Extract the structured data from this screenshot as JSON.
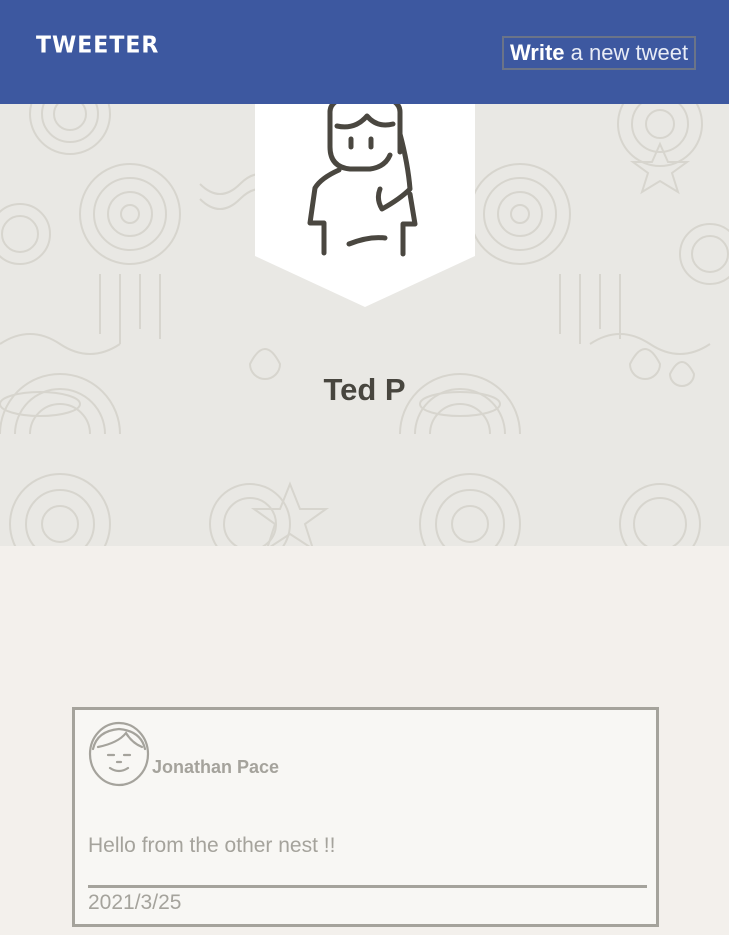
{
  "header": {
    "logo": "TWEETER",
    "write_button": {
      "strong": "Write",
      "rest": " a new tweet"
    }
  },
  "profile": {
    "name": "Ted P"
  },
  "tweets": [
    {
      "author": "Jonathan Pace",
      "text": "Hello from the other nest !!",
      "date": "2021/3/25"
    }
  ],
  "colors": {
    "header_bg": "#3d58a0",
    "page_bg": "#f3f0ec",
    "banner_bg": "#e9e8e4",
    "name_text": "#48463f",
    "card_border": "#a5a39c"
  }
}
